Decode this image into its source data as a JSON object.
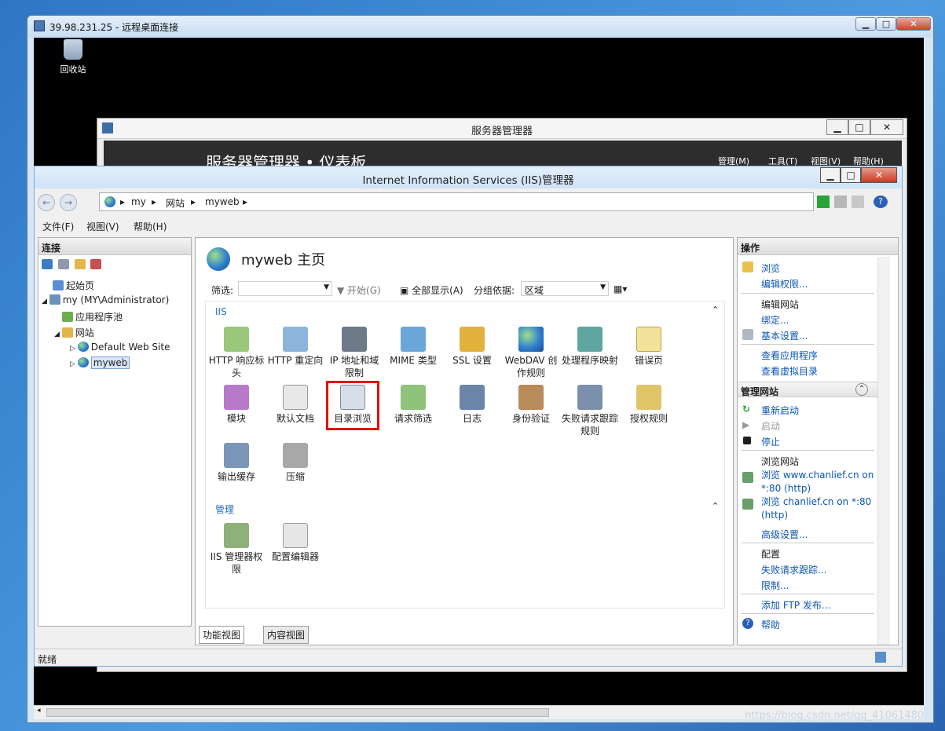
{
  "rdp": {
    "title": "39.98.231.25 - 远程桌面连接",
    "recycle_label": "回收站"
  },
  "server_manager": {
    "title": "服务器管理器",
    "breadcrumb": "服务器管理器 • 仪表板",
    "menu": [
      "管理(M)",
      "工具(T)",
      "视图(V)",
      "帮助(H)"
    ]
  },
  "iis": {
    "title": "Internet Information Services (IIS)管理器",
    "address": [
      "my",
      "网站",
      "myweb"
    ],
    "menu": [
      "文件(F)",
      "视图(V)",
      "帮助(H)"
    ],
    "connections": {
      "header": "连接",
      "tree": [
        "起始页",
        "my (MY\\Administrator)",
        "应用程序池",
        "网站",
        "Default Web Site",
        "myweb"
      ]
    },
    "center": {
      "title": "myweb 主页",
      "filter_label": "筛选:",
      "go_label": "开始(G)",
      "show_all": "全部显示(A)",
      "group_by_label": "分组依据:",
      "group_by_value": "区域",
      "groups": [
        {
          "name": "IIS",
          "items": [
            "HTTP 响应标头",
            "HTTP 重定向",
            "IP 地址和域限制",
            "MIME 类型",
            "SSL 设置",
            "WebDAV 创作规则",
            "处理程序映射",
            "错误页",
            "模块",
            "默认文档",
            "目录浏览",
            "请求筛选",
            "日志",
            "身份验证",
            "失败请求跟踪规则",
            "授权规则",
            "输出缓存",
            "压缩"
          ]
        },
        {
          "name": "管理",
          "items": [
            "IIS 管理器权限",
            "配置编辑器"
          ]
        }
      ],
      "tabs": [
        "功能视图",
        "内容视图"
      ]
    },
    "actions": {
      "header": "操作",
      "items": [
        {
          "t": "浏览",
          "kind": "link"
        },
        {
          "t": "编辑权限...",
          "kind": "link"
        },
        {
          "t": "编辑网站",
          "kind": "group"
        },
        {
          "t": "绑定...",
          "kind": "link"
        },
        {
          "t": "基本设置...",
          "kind": "link"
        },
        {
          "t": "查看应用程序",
          "kind": "link"
        },
        {
          "t": "查看虚拟目录",
          "kind": "link"
        },
        {
          "t": "管理网站",
          "kind": "section"
        },
        {
          "t": "重新启动",
          "kind": "link"
        },
        {
          "t": "启动",
          "kind": "disabled"
        },
        {
          "t": "停止",
          "kind": "link"
        },
        {
          "t": "浏览网站",
          "kind": "group"
        },
        {
          "t": "浏览 www.chanlief.cn on *:80 (http)",
          "kind": "link"
        },
        {
          "t": "浏览 chanlief.cn on *:80 (http)",
          "kind": "link"
        },
        {
          "t": "高级设置...",
          "kind": "link"
        },
        {
          "t": "配置",
          "kind": "group"
        },
        {
          "t": "失败请求跟踪...",
          "kind": "link"
        },
        {
          "t": "限制...",
          "kind": "link"
        },
        {
          "t": "添加 FTP 发布...",
          "kind": "link"
        },
        {
          "t": "帮助",
          "kind": "link"
        }
      ]
    },
    "status": "就绪"
  },
  "watermark": "https://blog.csdn.net/qq_41061480",
  "colors": {
    "accent": "#0b55b5",
    "selection": "#e01010"
  }
}
